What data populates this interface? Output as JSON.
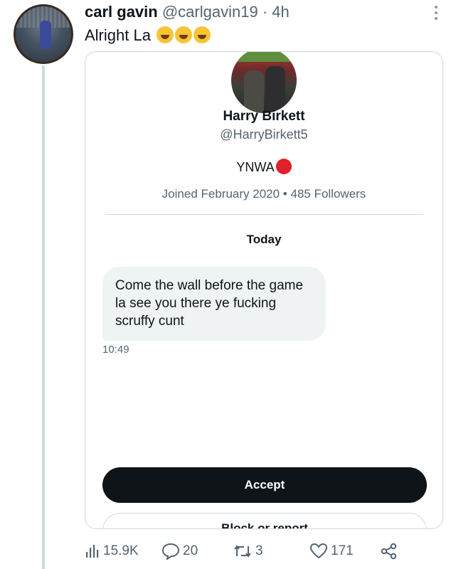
{
  "tweet": {
    "author_name": "carl gavin",
    "author_handle": "@carlgavin19",
    "separator": "·",
    "time": "4h",
    "text": "Alright La",
    "emojis": [
      "rolling-on-floor-laughing",
      "rolling-on-floor-laughing",
      "rolling-on-floor-laughing"
    ]
  },
  "card": {
    "profile_name": "Harry Birkett",
    "profile_handle": "@HarryBirkett5",
    "bio": "YNWA",
    "joined_text": "Joined February 2020",
    "meta_separator": "•",
    "followers_text": "485 Followers",
    "date_label": "Today",
    "message": {
      "line1": "Come the wall before the game",
      "line2": "la see you there ye fucking",
      "line3": "scruffy cunt",
      "time": "10:49"
    },
    "accept_label": "Accept",
    "block_label": "Block or report"
  },
  "actions": {
    "views": "15.9K",
    "replies": "20",
    "retweets": "3",
    "likes": "171"
  },
  "colors": {
    "text_primary": "#0f1419",
    "text_secondary": "#536471",
    "border": "#cfd9de",
    "bubble": "#eff3f4",
    "accept_bg": "#0f1419"
  },
  "icons": [
    "more-icon",
    "views-icon",
    "reply-icon",
    "retweet-icon",
    "like-icon",
    "share-icon"
  ]
}
